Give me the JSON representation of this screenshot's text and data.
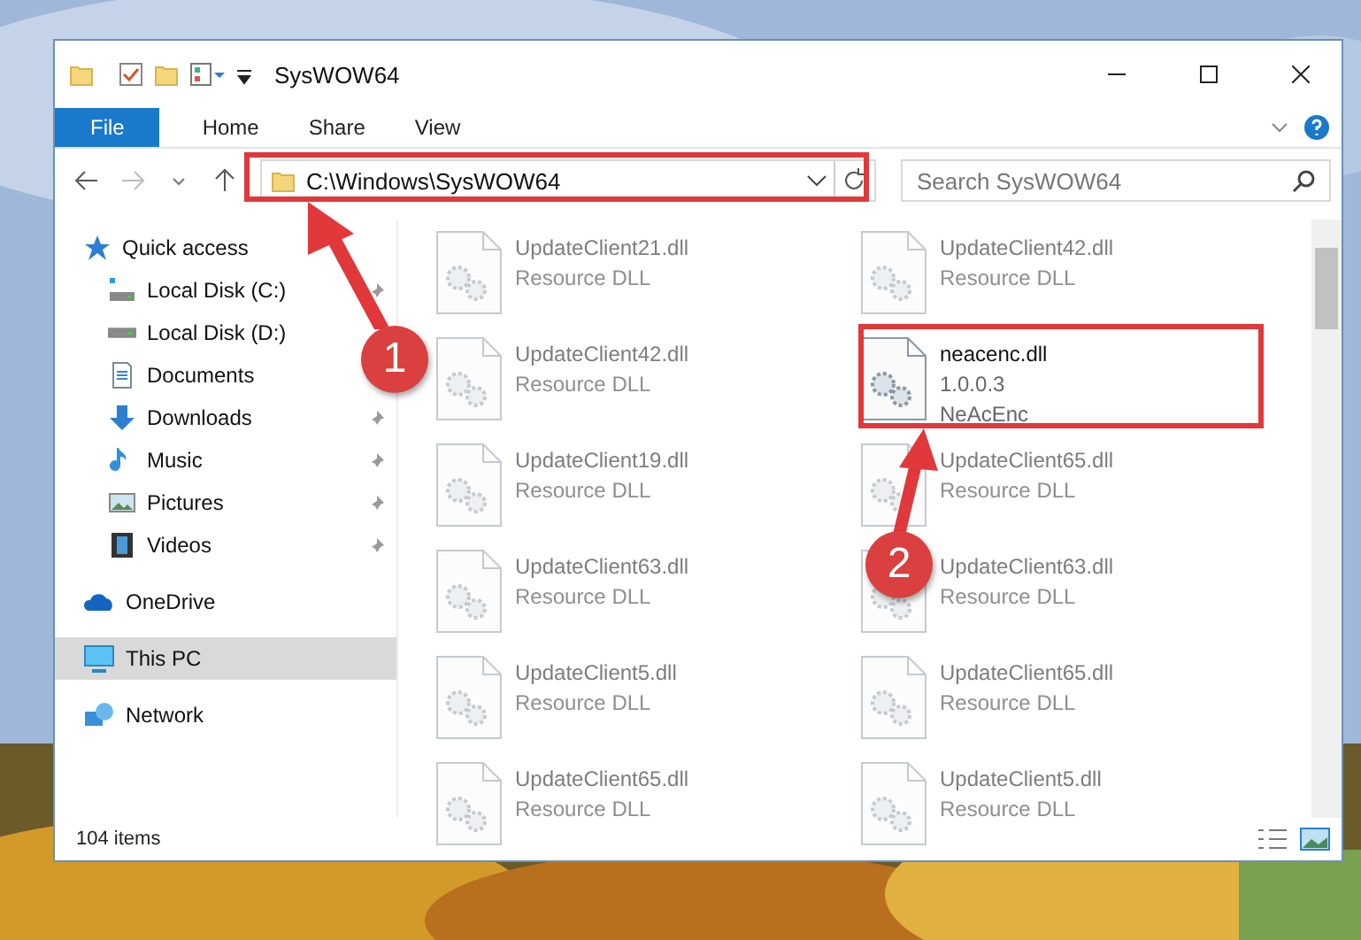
{
  "window": {
    "title": "SysWOW64"
  },
  "ribbon_tabs": [
    {
      "label": "File",
      "kind": "file"
    },
    {
      "label": "Home",
      "kind": "tab"
    },
    {
      "label": "Share",
      "kind": "tab"
    },
    {
      "label": "View",
      "kind": "tab"
    }
  ],
  "address_bar": {
    "path": "C:\\Windows\\SysWOW64"
  },
  "search": {
    "placeholder": "Search SysWOW64"
  },
  "navigation": [
    {
      "label": "Quick access",
      "selected": false,
      "children": [
        {
          "label": "Local Disk (C:)",
          "pinned": true,
          "selected": false
        },
        {
          "label": "Local Disk (D:)",
          "selected": false
        },
        {
          "label": "Documents",
          "selected": false
        },
        {
          "label": "Downloads",
          "pinned": true,
          "selected": false
        },
        {
          "label": "Music",
          "pinned": true,
          "selected": false
        },
        {
          "label": "Pictures",
          "pinned": true,
          "selected": false
        },
        {
          "label": "Videos",
          "pinned": true,
          "selected": false
        }
      ]
    },
    {
      "label": "OneDrive",
      "selected": false
    },
    {
      "label": "This PC",
      "selected": true
    },
    {
      "label": "Network",
      "selected": false
    }
  ],
  "files": [
    {
      "name": "UpdateClient21.dll",
      "details": [
        "Resource DLL"
      ],
      "kind": "blurred"
    },
    {
      "name": "UpdateClient42.dll",
      "details": [
        "Resource DLL"
      ],
      "kind": "blurred"
    },
    {
      "name": "UpdateClient42.dll",
      "details": [
        "Resource DLL"
      ],
      "kind": "blurred"
    },
    {
      "name": "neacenc.dll",
      "details": [
        "1.0.0.3",
        "NeAcEnc"
      ],
      "kind": "clear"
    },
    {
      "name": "UpdateClient19.dll",
      "details": [
        "Resource DLL"
      ],
      "kind": "blurred"
    },
    {
      "name": "UpdateClient65.dll",
      "details": [
        "Resource DLL"
      ],
      "kind": "blurred"
    },
    {
      "name": "UpdateClient63.dll",
      "details": [
        "Resource DLL"
      ],
      "kind": "blurred"
    },
    {
      "name": "UpdateClient63.dll",
      "details": [
        "Resource DLL"
      ],
      "kind": "blurred"
    },
    {
      "name": "UpdateClient5.dll",
      "details": [
        "Resource DLL"
      ],
      "kind": "blurred"
    },
    {
      "name": "UpdateClient65.dll",
      "details": [
        "Resource DLL"
      ],
      "kind": "blurred"
    },
    {
      "name": "UpdateClient65.dll",
      "details": [
        "Resource DLL"
      ],
      "kind": "blurred"
    },
    {
      "name": "UpdateClient5.dll",
      "details": [
        "Resource DLL"
      ],
      "kind": "blurred"
    }
  ],
  "status_bar": {
    "item_count": "104 items"
  },
  "annotations": [
    {
      "label": "1"
    },
    {
      "label": "2"
    }
  ]
}
